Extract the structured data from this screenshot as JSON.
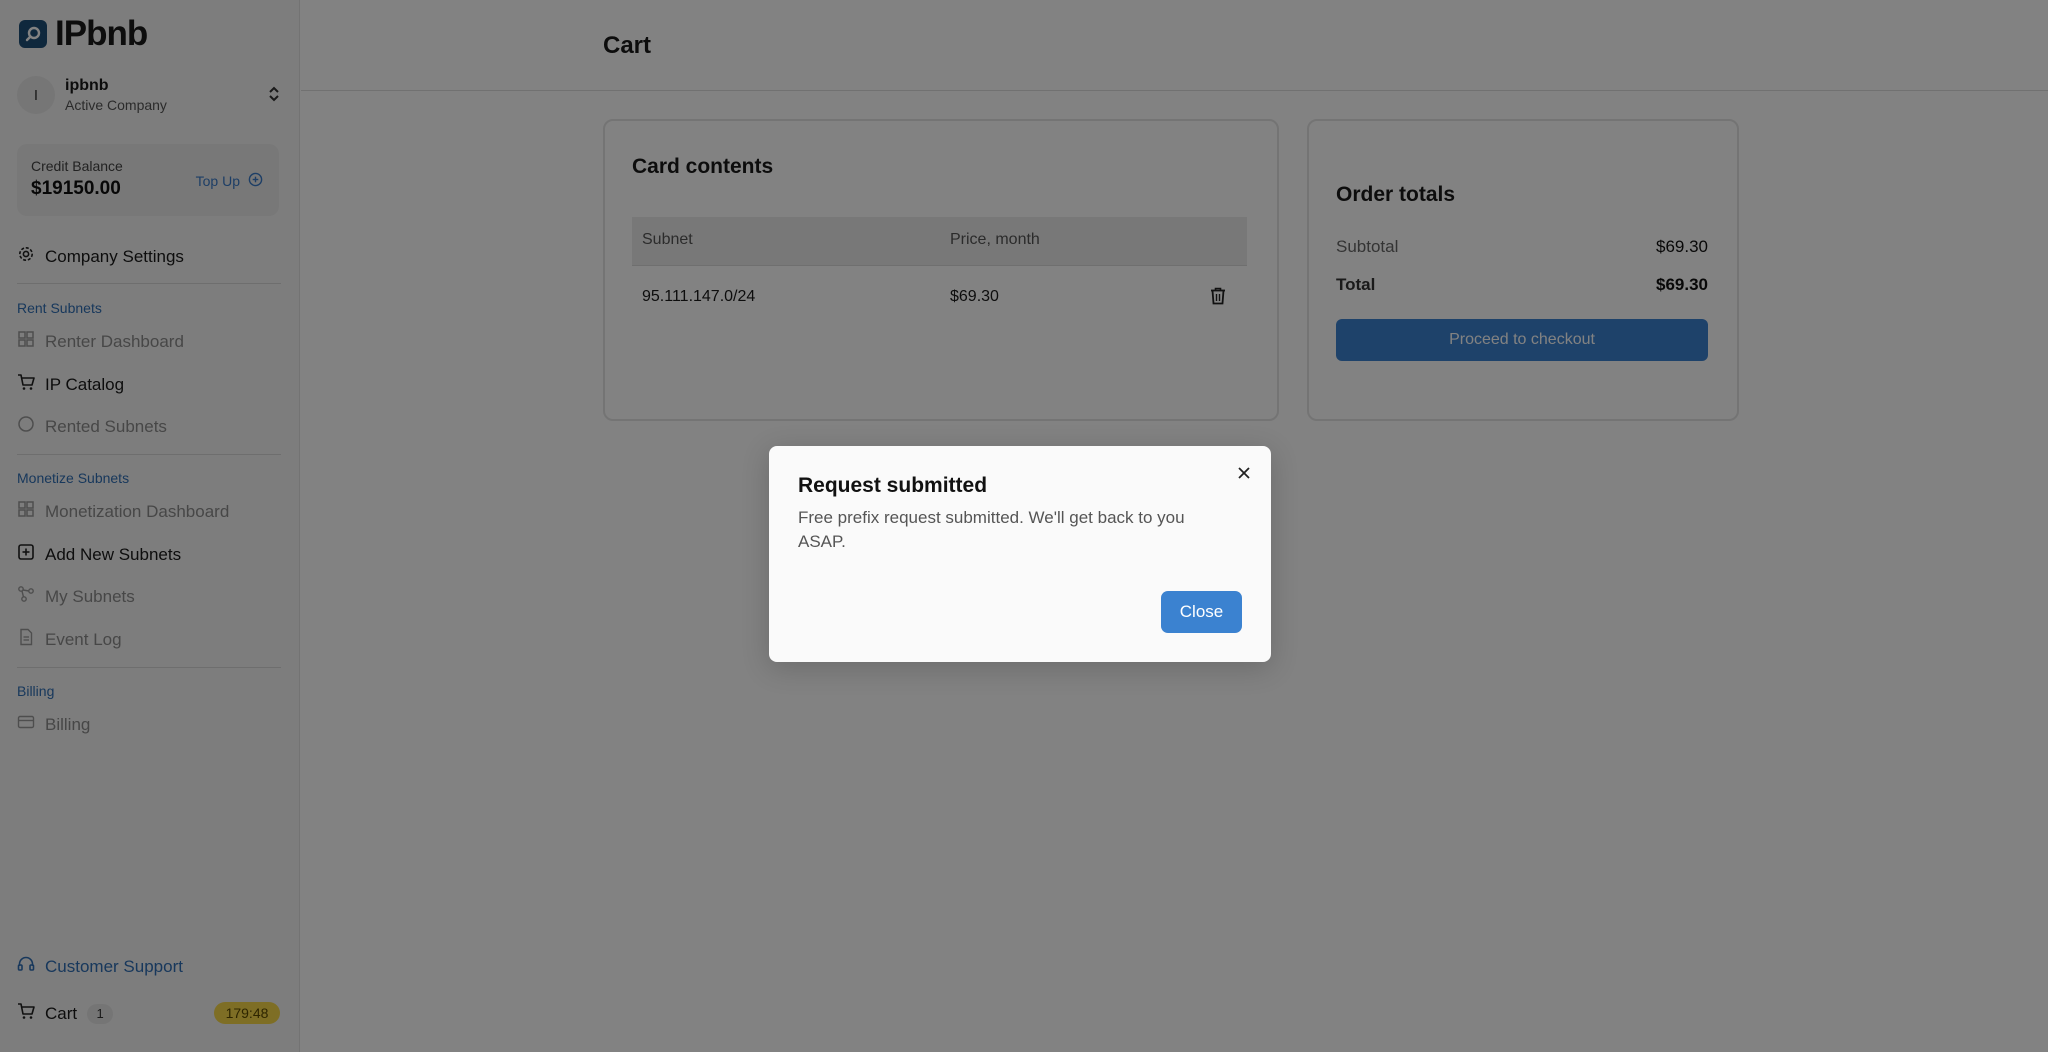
{
  "brand": {
    "name": "IPbnb"
  },
  "company": {
    "initial": "I",
    "name": "ipbnb",
    "subtitle": "Active Company"
  },
  "credit": {
    "label": "Credit Balance",
    "value": "$19150.00",
    "topup_label": "Top Up"
  },
  "nav": {
    "company_settings": "Company Settings",
    "rent_section": "Rent Subnets",
    "renter_dashboard": "Renter Dashboard",
    "ip_catalog": "IP Catalog",
    "rented_subnets": "Rented Subnets",
    "monetize_section": "Monetize Subnets",
    "monetization_dashboard": "Monetization Dashboard",
    "add_new_subnets": "Add New Subnets",
    "my_subnets": "My Subnets",
    "event_log": "Event Log",
    "billing_section": "Billing",
    "billing": "Billing",
    "customer_support": "Customer Support",
    "cart": "Cart",
    "cart_count": "1",
    "timer": "179:48"
  },
  "page": {
    "title": "Cart"
  },
  "cart": {
    "title": "Card contents",
    "columns": [
      "Subnet",
      "Price, month"
    ],
    "rows": [
      {
        "subnet": "95.111.147.0/24",
        "price": "$69.30"
      }
    ]
  },
  "totals": {
    "title": "Order totals",
    "subtotal_label": "Subtotal",
    "subtotal_value": "$69.30",
    "total_label": "Total",
    "total_value": "$69.30",
    "checkout_label": "Proceed to checkout"
  },
  "modal": {
    "title": "Request submitted",
    "body": "Free prefix request submitted. We'll get back to you ASAP.",
    "close_label": "Close"
  },
  "colors": {
    "accent": "#3b82d0",
    "section_label": "#2f6fb5",
    "timer_bg": "#f7d84a",
    "overlay": "rgba(0,0,0,0.49)"
  }
}
